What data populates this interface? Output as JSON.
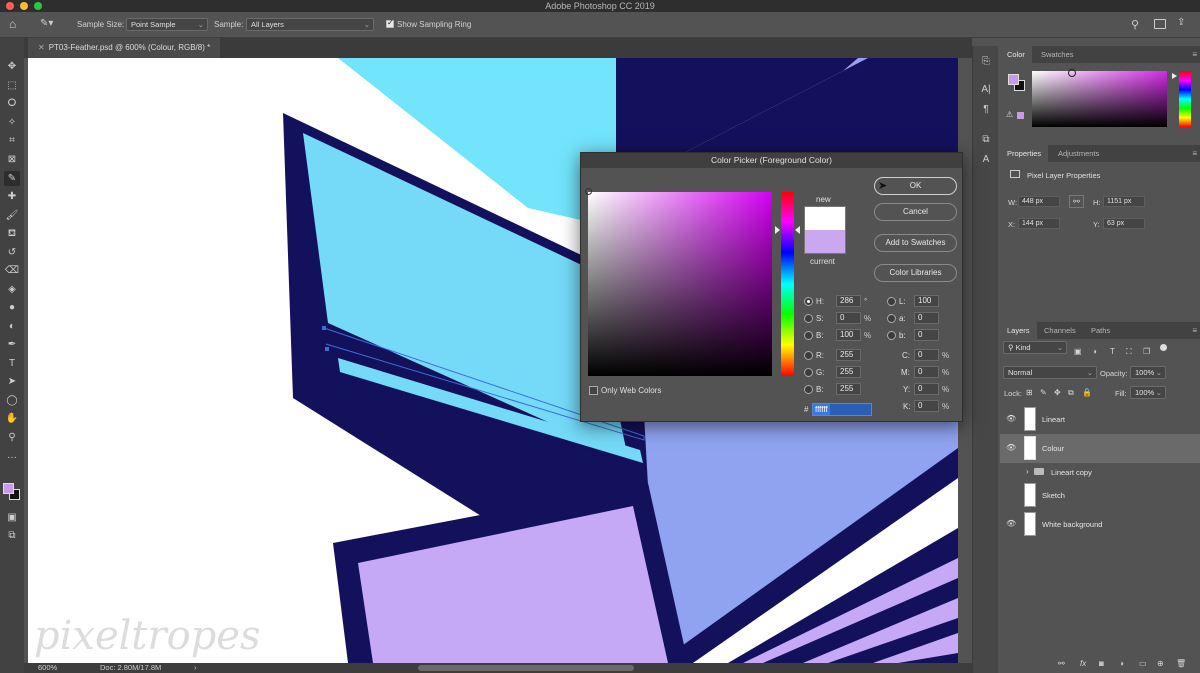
{
  "window": {
    "title": "Adobe Photoshop CC 2019"
  },
  "options_bar": {
    "sample_size_label": "Sample Size:",
    "sample_size_value": "Point Sample",
    "sample_label": "Sample:",
    "sample_value": "All Layers",
    "show_ring_label": "Show Sampling Ring",
    "show_ring_checked": true
  },
  "document": {
    "tab_title": "PT03-Feather.psd @ 600% (Colour, RGB/8) *",
    "zoom": "600%",
    "doc_info": "Doc: 2.80M/17.8M",
    "watermark": "pixeltropes"
  },
  "color_panel": {
    "tabs": [
      "Color",
      "Swatches"
    ],
    "foreground": "#c89ae8",
    "background": "#111111"
  },
  "properties_panel": {
    "tabs": [
      "Properties",
      "Adjustments"
    ],
    "section": "Pixel Layer Properties",
    "w_label": "W:",
    "w_value": "448 px",
    "h_label": "H:",
    "h_value": "1151 px",
    "x_label": "X:",
    "x_value": "144 px",
    "y_label": "Y:",
    "y_value": "63 px"
  },
  "layers_panel": {
    "tabs": [
      "Layers",
      "Channels",
      "Paths"
    ],
    "filter": "Kind",
    "blend_mode": "Normal",
    "opacity_label": "Opacity:",
    "opacity": "100%",
    "lock_label": "Lock:",
    "fill_label": "Fill:",
    "fill": "100%",
    "layers": [
      {
        "name": "Lineart",
        "visible": true,
        "selected": false
      },
      {
        "name": "Colour",
        "visible": true,
        "selected": true
      },
      {
        "name": "Lineart copy",
        "visible": false,
        "selected": false,
        "group": true
      },
      {
        "name": "Sketch",
        "visible": false,
        "selected": false
      },
      {
        "name": "White background",
        "visible": true,
        "selected": false
      }
    ]
  },
  "color_picker": {
    "title": "Color Picker (Foreground Color)",
    "new_label": "new",
    "current_label": "current",
    "new_color": "#ffffff",
    "current_color": "#c9a8f0",
    "buttons": {
      "ok": "OK",
      "cancel": "Cancel",
      "add_swatches": "Add to Swatches",
      "libraries": "Color Libraries"
    },
    "hsb": {
      "h_label": "H:",
      "h": "286",
      "h_unit": "°",
      "s_label": "S:",
      "s": "0",
      "s_unit": "%",
      "b_label": "B:",
      "b": "100",
      "b_unit": "%"
    },
    "rgb": {
      "r_label": "R:",
      "r": "255",
      "g_label": "G:",
      "g": "255",
      "b_label": "B:",
      "b": "255"
    },
    "lab": {
      "l_label": "L:",
      "l": "100",
      "a_label": "a:",
      "a": "0",
      "b_label": "b:",
      "b": "0"
    },
    "cmyk": {
      "c_label": "C:",
      "c": "0",
      "m_label": "M:",
      "m": "0",
      "y_label": "Y:",
      "y": "0",
      "k_label": "K:",
      "k": "0",
      "unit": "%"
    },
    "hex_label": "#",
    "hex": "ffffff",
    "web_colors_label": "Only Web Colors"
  }
}
